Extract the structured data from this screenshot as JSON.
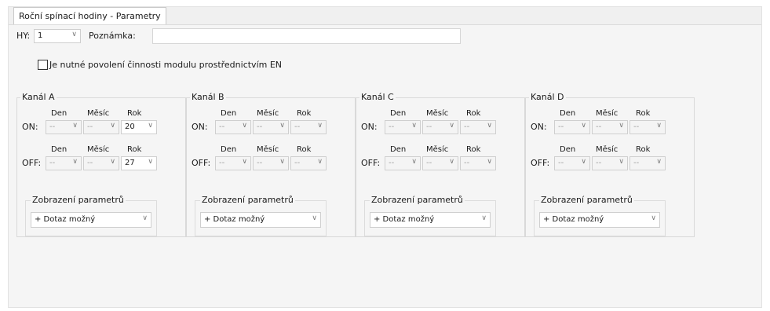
{
  "tab": {
    "title": "Roční spínací hodiny - Parametry"
  },
  "hy": {
    "label": "HY:",
    "value": "1"
  },
  "note": {
    "label": "Poznámka:",
    "value": ""
  },
  "enable": {
    "label": "Je nutné povolení činnosti modulu prostřednictvím EN",
    "checked": false
  },
  "columns": {
    "day": "Den",
    "month": "Měsíc",
    "year": "Rok"
  },
  "rows": {
    "on": "ON:",
    "off": "OFF:"
  },
  "display": {
    "title": "Zobrazení parametrů",
    "value": "+ Dotaz možný"
  },
  "channels": [
    {
      "name": "Kanál A",
      "on": [
        "--",
        "--",
        "20"
      ],
      "off": [
        "--",
        "--",
        "27"
      ]
    },
    {
      "name": "Kanál B",
      "on": [
        "--",
        "--",
        "--"
      ],
      "off": [
        "--",
        "--",
        "--"
      ]
    },
    {
      "name": "Kanál C",
      "on": [
        "--",
        "--",
        "--"
      ],
      "off": [
        "--",
        "--",
        "--"
      ]
    },
    {
      "name": "Kanál D",
      "on": [
        "--",
        "--",
        "--"
      ],
      "off": [
        "--",
        "--",
        "--"
      ]
    }
  ]
}
